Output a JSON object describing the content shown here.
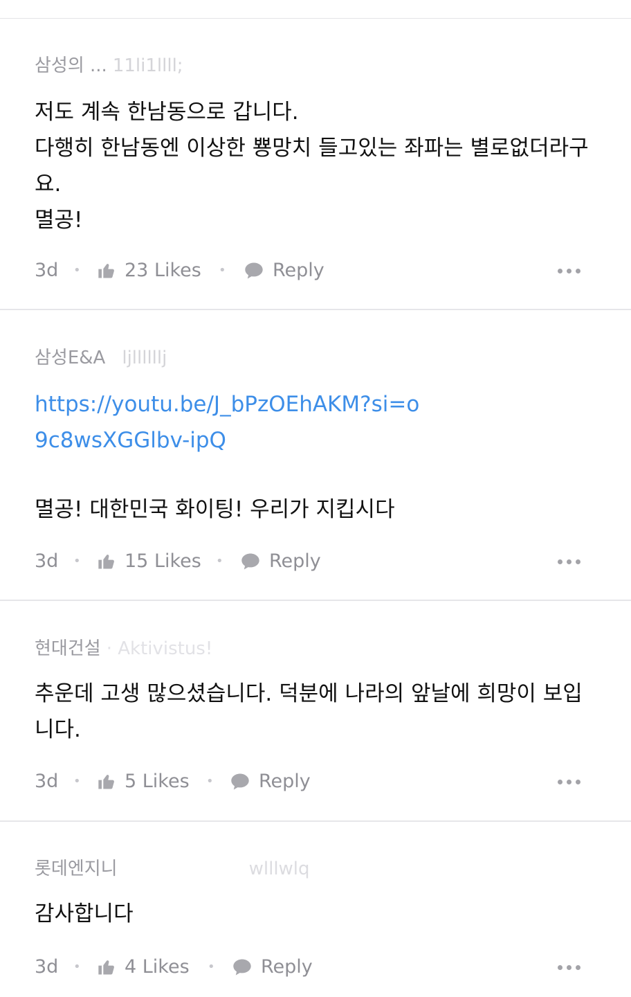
{
  "comments": [
    {
      "author": "삼성의 ...",
      "author_tail": "11li1llll;",
      "body": "저도 계속 한남동으로 갑니다.\n다행히 한남동엔 이상한 뿅망치 들고있는 좌파는 별로없더라구요.\n멸공!",
      "time": "3d",
      "likes": "23 Likes",
      "reply": "Reply"
    },
    {
      "author": "삼성E&A",
      "author_tail": "ljllllllj",
      "link": "https://youtu.be/J_bPzOEhAKM?si=o9c8wsXGGlbv-ipQ",
      "body": "멸공! 대한민국 화이팅!  우리가 지킵시다",
      "time": "3d",
      "likes": "15 Likes",
      "reply": "Reply"
    },
    {
      "author": "현대건설",
      "author_tail": "· Aktivistus!",
      "body": "추운데 고생 많으셨습니다. 덕분에 나라의 앞날에 희망이 보입니다.",
      "time": "3d",
      "likes": "5 Likes",
      "reply": "Reply"
    },
    {
      "author": "롯데엔지니",
      "author_tail": "wlllwlq",
      "body": "감사합니다",
      "time": "3d",
      "likes": "4 Likes",
      "reply": "Reply"
    }
  ],
  "colors": {
    "link": "#3d8ee8",
    "meta": "#8f8f95",
    "divider": "#e6e6e9"
  },
  "icons": [
    "thumbs-up-icon",
    "speech-bubble-icon",
    "more-dots-icon"
  ]
}
